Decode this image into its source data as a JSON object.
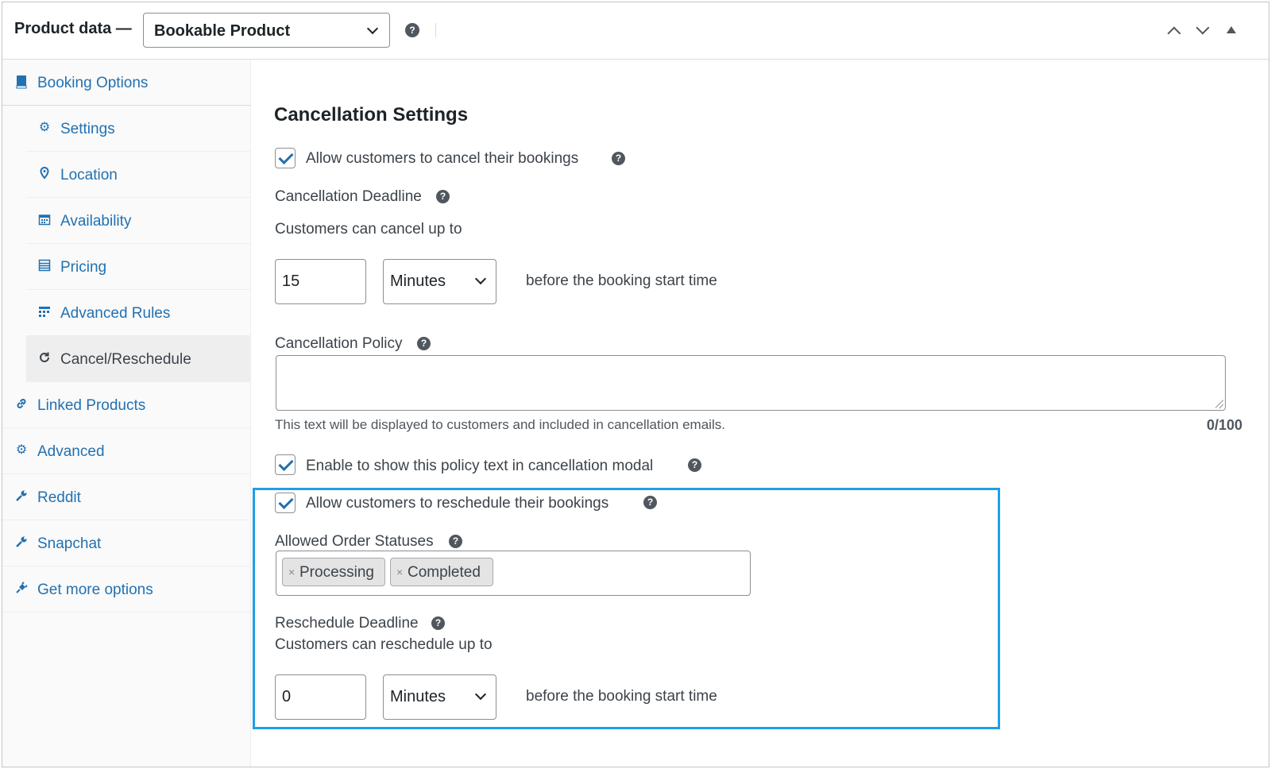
{
  "header": {
    "title": "Product data —",
    "product_type": "Bookable Product"
  },
  "sidebar": {
    "items": [
      {
        "label": "Booking Options",
        "icon": "book-icon"
      },
      {
        "label": "Settings",
        "icon": "gear-icon"
      },
      {
        "label": "Location",
        "icon": "location-pin-icon"
      },
      {
        "label": "Availability",
        "icon": "calendar-icon"
      },
      {
        "label": "Pricing",
        "icon": "list-icon"
      },
      {
        "label": "Advanced Rules",
        "icon": "grid-icon"
      },
      {
        "label": "Cancel/Reschedule",
        "icon": "refresh-icon"
      },
      {
        "label": "Linked Products",
        "icon": "link-icon"
      },
      {
        "label": "Advanced",
        "icon": "gear-icon"
      },
      {
        "label": "Reddit",
        "icon": "wrench-icon"
      },
      {
        "label": "Snapchat",
        "icon": "wrench-icon"
      },
      {
        "label": "Get more options",
        "icon": "plugin-icon"
      }
    ]
  },
  "main": {
    "section_title": "Cancellation Settings",
    "allow_cancel_label": "Allow customers to cancel their bookings",
    "cancel_deadline_label": "Cancellation Deadline",
    "cancel_up_to": "Customers can cancel up to",
    "cancel_amount": "15",
    "cancel_unit": "Minutes",
    "before_start": "before the booking start time",
    "policy_label": "Cancellation Policy",
    "policy_value": "",
    "policy_hint": "This text will be displayed to customers and included in cancellation emails.",
    "policy_counter": "0/100",
    "show_policy_label": "Enable to show this policy text in cancellation modal",
    "allow_reschedule_label": "Allow customers to reschedule their bookings",
    "statuses_label": "Allowed Order Statuses",
    "statuses": [
      "Processing",
      "Completed"
    ],
    "reschedule_deadline_label": "Reschedule Deadline",
    "reschedule_up_to": "Customers can reschedule up to",
    "reschedule_amount": "0",
    "reschedule_unit": "Minutes",
    "reschedule_before_start": "before the booking start time"
  },
  "colors": {
    "link": "#2271b1",
    "highlight": "#1fa0e6"
  }
}
